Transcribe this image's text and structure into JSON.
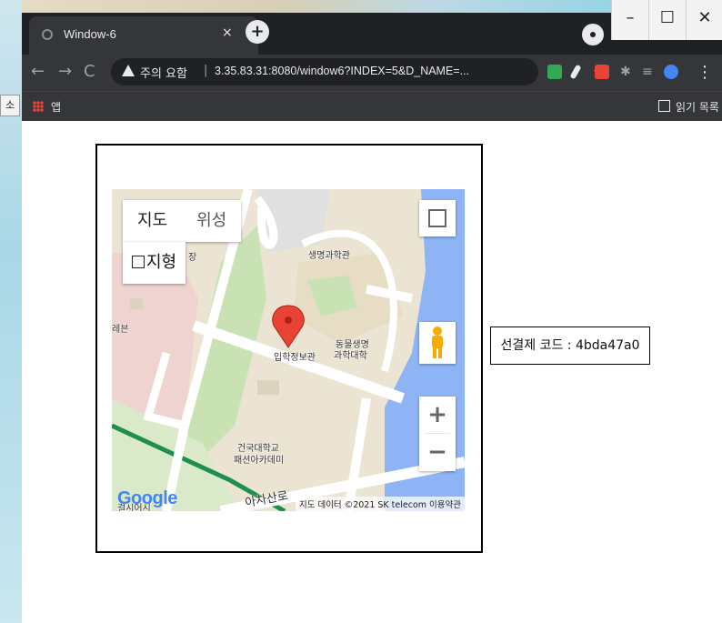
{
  "desktop": {
    "side_button_label": "소"
  },
  "browser": {
    "tab_title": "Window-6",
    "tab_close": "×",
    "new_tab": "+",
    "window_controls": {
      "minimize": "–",
      "maximize": "☐",
      "close": "✕"
    },
    "security_warning": "주의 요함",
    "separator": "|",
    "url": "3.35.83.31:8080/window6?INDEX=5&D_NAME=...",
    "apps_label": "앱",
    "reading_list_label": "읽기 목록"
  },
  "map": {
    "type_map_label": "지도",
    "type_satellite_label": "위성",
    "terrain_label": "지형",
    "zoom_in": "+",
    "zoom_out": "−",
    "google_logo": "Google",
    "attribution": "지도 데이터 ©2021 SK telecom   이용약관",
    "labels": {
      "bio_science": "생명과학관",
      "admissions": "입학정보관",
      "animal_life": "동물생명",
      "animal_life2": "과학대학",
      "konkuk": "건국대학교",
      "fashion": "패션아카데미",
      "road": "아차산로",
      "left1": "장",
      "left2": "레븐",
      "left3": "걸시어시"
    },
    "marker_color": "#ea4335"
  },
  "code_box": {
    "text": "선결제 코드 : 4bda47a0"
  }
}
